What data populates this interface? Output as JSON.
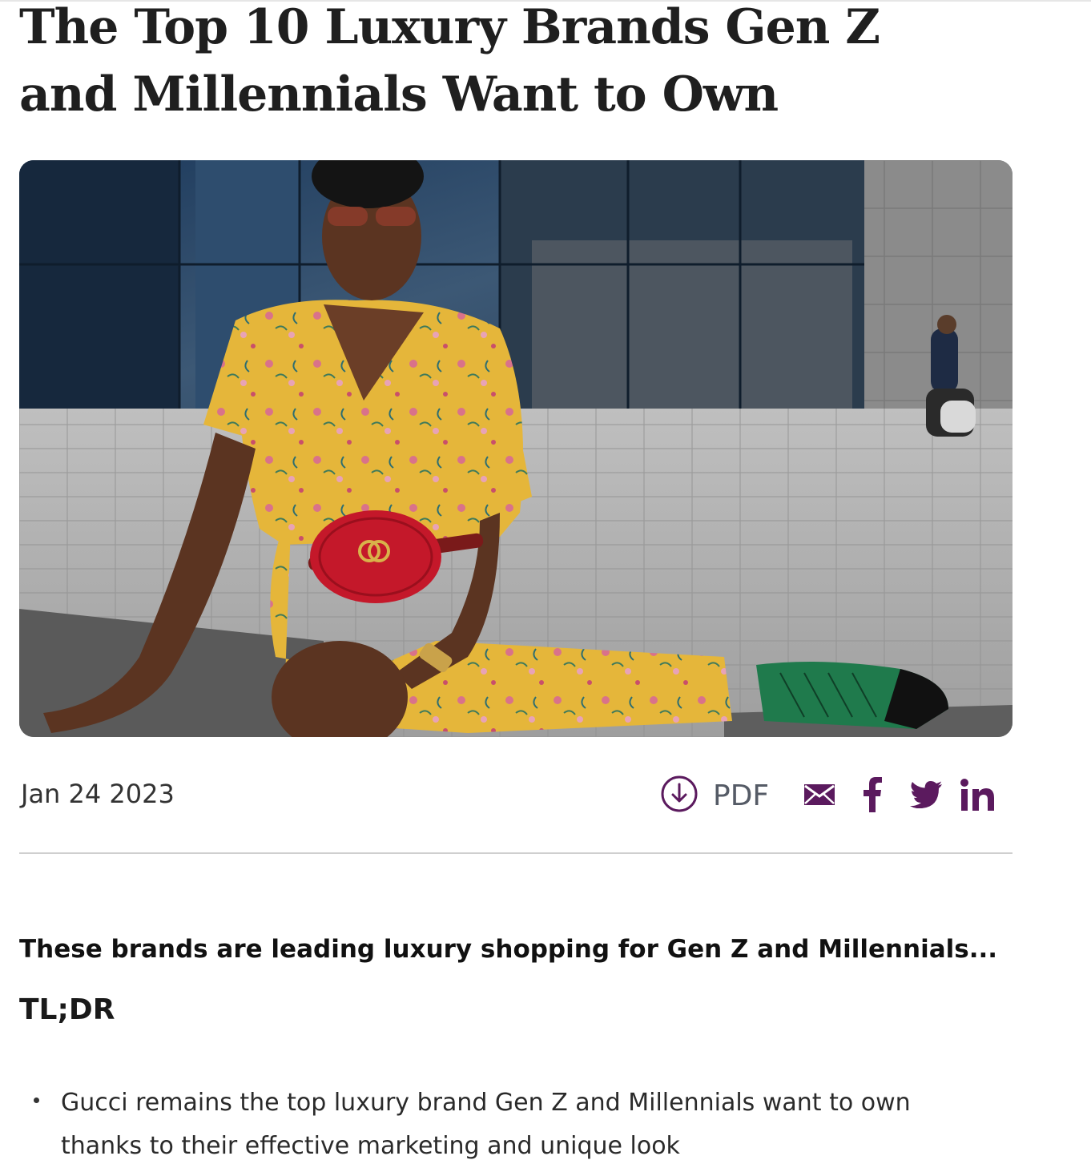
{
  "article": {
    "title": "The Top 10 Luxury Brands Gen Z and Millennials Want to Own",
    "date": "Jan 24 2023",
    "lead": "These brands are leading luxury shopping for Gen Z and Millennials...",
    "tldr_heading": "TL;DR",
    "bullets": [
      "Gucci remains the top luxury brand Gen Z and Millennials want to own thanks to their effective marketing and unique look"
    ]
  },
  "hero_image": {
    "alt": "Woman in yellow floral dress wearing a red belt bag sitting on pavement"
  },
  "toolbar": {
    "pdf_label": "PDF",
    "icons": [
      "download-icon",
      "email-icon",
      "facebook-icon",
      "twitter-icon",
      "linkedin-icon"
    ]
  },
  "colors": {
    "accent": "#5b1a5e",
    "text": "#1f1f1f"
  }
}
